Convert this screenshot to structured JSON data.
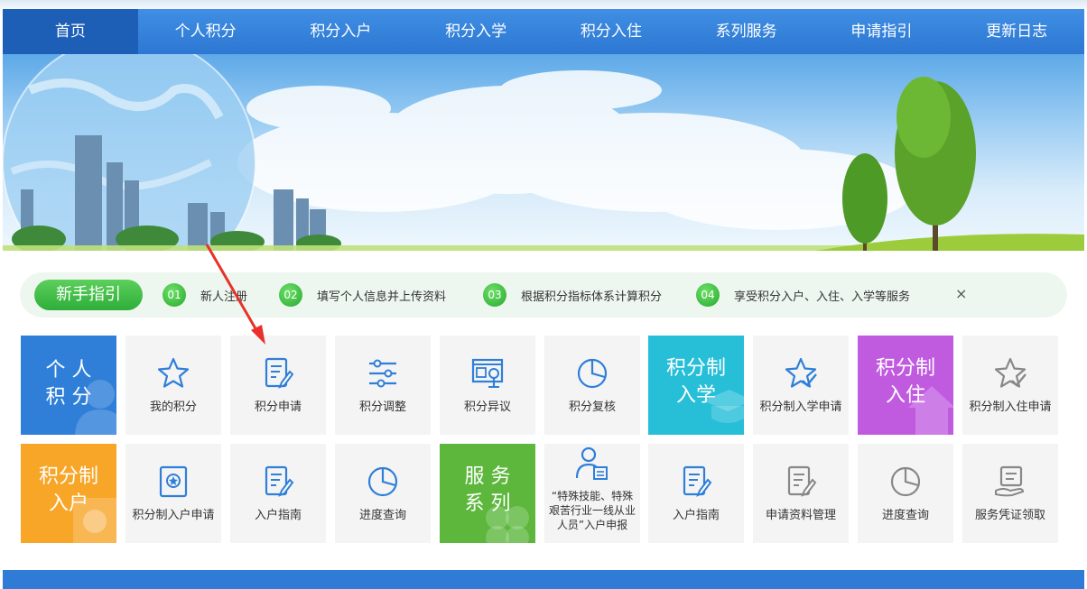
{
  "nav": {
    "items": [
      {
        "label": "首页",
        "active": true
      },
      {
        "label": "个人积分"
      },
      {
        "label": "积分入户"
      },
      {
        "label": "积分入学"
      },
      {
        "label": "积分入住"
      },
      {
        "label": "系列服务"
      },
      {
        "label": "申请指引"
      },
      {
        "label": "更新日志"
      }
    ]
  },
  "guide": {
    "title": "新手指引",
    "steps": [
      {
        "num": "01",
        "text": "新人注册"
      },
      {
        "num": "02",
        "text": "填写个人信息并上传资料"
      },
      {
        "num": "03",
        "text": "根据积分指标体系计算积分"
      },
      {
        "num": "04",
        "text": "享受积分入户、入住、入学等服务"
      }
    ],
    "close": "×"
  },
  "tiles": {
    "personal": {
      "title_line1": "个 人",
      "title_line2": "积 分"
    },
    "my_points": "我的积分",
    "apply": "积分申请",
    "adjust": "积分调整",
    "objection": "积分异议",
    "review": "积分复核",
    "school": {
      "title_line1": "积分制",
      "title_line2": "入学"
    },
    "school_apply": "积分制入学申请",
    "housing": {
      "title_line1": "积分制",
      "title_line2": "入住"
    },
    "housing_apply": "积分制入住申请",
    "hukou": {
      "title_line1": "积分制",
      "title_line2": "入户"
    },
    "hukou_apply": "积分制入户申请",
    "hukou_guide": "入户指南",
    "progress": "进度查询",
    "service": {
      "title_line1": "服 务",
      "title_line2": "系 列"
    },
    "special": "“特殊技能、特殊艰苦行业一线从业人员”入户申报",
    "guide2": "入户指南",
    "materials": "申请资料管理",
    "progress2": "进度查询",
    "voucher": "服务凭证领取"
  },
  "colors": {
    "nav": "#2d77d2",
    "personal": "#2f7fd9",
    "school": "#27bfd8",
    "housing": "#c05be0",
    "hukou": "#f7a628",
    "service": "#5cb73c",
    "icon": "#2f7fd9",
    "annotation_arrow": "#e8312a"
  }
}
